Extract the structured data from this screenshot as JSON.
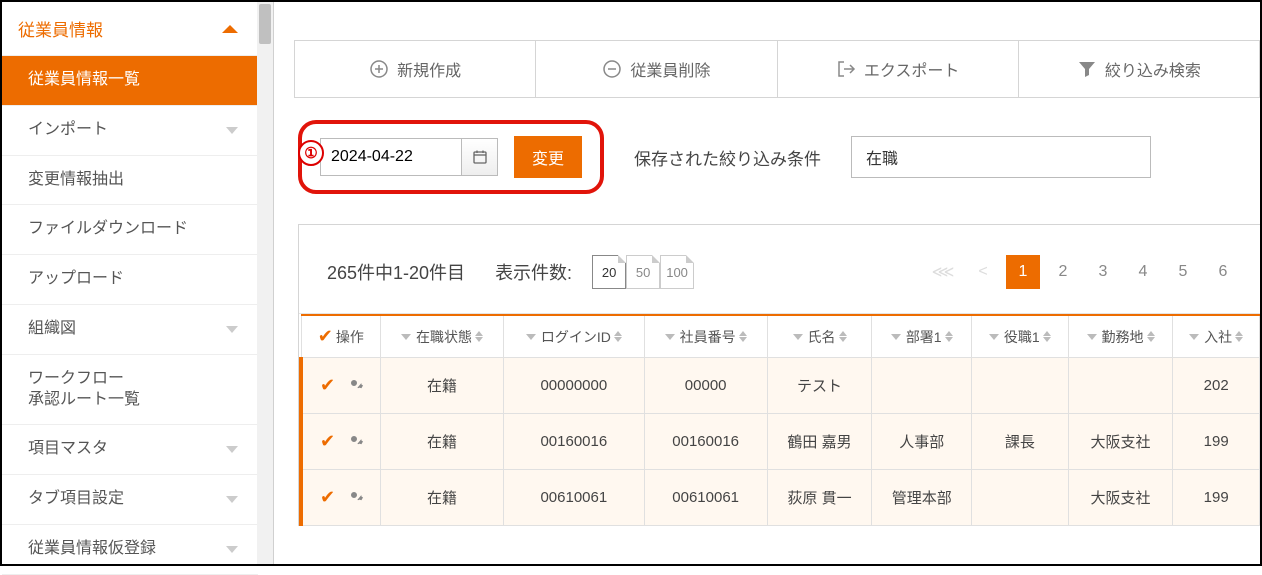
{
  "annotation": {
    "badge": "①"
  },
  "sidebar": {
    "header": "従業員情報",
    "items": [
      {
        "label": "従業員情報一覧",
        "active": true,
        "expandable": false
      },
      {
        "label": "インポート",
        "expandable": true
      },
      {
        "label": "変更情報抽出",
        "expandable": false
      },
      {
        "label": "ファイルダウンロード",
        "expandable": false
      },
      {
        "label": "アップロード",
        "expandable": false
      },
      {
        "label": "組織図",
        "expandable": true
      },
      {
        "label": "ワークフロー\n承認ルート一覧",
        "expandable": false
      },
      {
        "label": "項目マスタ",
        "expandable": true
      },
      {
        "label": "タブ項目設定",
        "expandable": true
      },
      {
        "label": "従業員情報仮登録",
        "expandable": true
      }
    ]
  },
  "toolbar": {
    "new": "新規作成",
    "delete": "従業員削除",
    "export": "エクスポート",
    "filter": "絞り込み検索"
  },
  "daterow": {
    "date_value": "2024-04-22",
    "change_btn": "変更",
    "saved_filter_label": "保存された絞り込み条件",
    "saved_filter_value": "在職"
  },
  "pager": {
    "range_text": "265件中1-20件目",
    "size_label": "表示件数:",
    "sizes": [
      "20",
      "50",
      "100"
    ],
    "active_size": "20",
    "pages": [
      "1",
      "2",
      "3",
      "4",
      "5",
      "6"
    ],
    "active_page": "1"
  },
  "table": {
    "columns": [
      "操作",
      "在職状態",
      "ログインID",
      "社員番号",
      "氏名",
      "部署1",
      "役職1",
      "勤務地",
      "入社"
    ],
    "rows": [
      {
        "status": "在籍",
        "login": "00000000",
        "empno": "00000",
        "name": "テスト",
        "dept": "",
        "pos": "",
        "loc": "",
        "hire": "202"
      },
      {
        "status": "在籍",
        "login": "00160016",
        "empno": "00160016",
        "name": "鶴田 嘉男",
        "dept": "人事部",
        "pos": "課長",
        "loc": "大阪支社",
        "hire": "199"
      },
      {
        "status": "在籍",
        "login": "00610061",
        "empno": "00610061",
        "name": "荻原 貫一",
        "dept": "管理本部",
        "pos": "",
        "loc": "大阪支社",
        "hire": "199"
      }
    ]
  },
  "colors": {
    "accent": "#ed6c00",
    "highlight": "#e1140a"
  }
}
